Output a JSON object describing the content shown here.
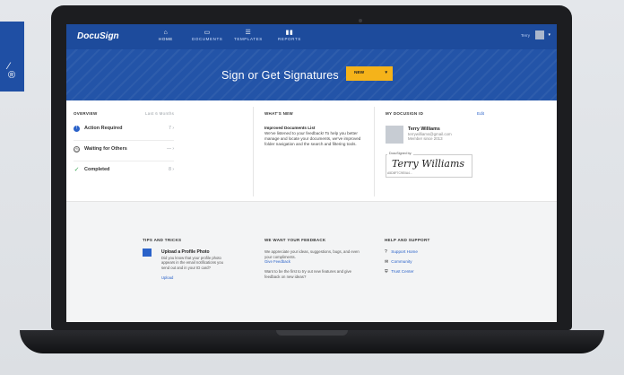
{
  "app": {
    "logo": "DocuSign"
  },
  "nav": [
    {
      "label": "HOME",
      "icon": "⌂",
      "active": true
    },
    {
      "label": "DOCUMENTS",
      "icon": "▭"
    },
    {
      "label": "TEMPLATES",
      "icon": "☰"
    },
    {
      "label": "REPORTS",
      "icon": "▮▮"
    }
  ],
  "header": {
    "user": "Terry",
    "hero_title": "Sign or Get Signatures",
    "new_button": "NEW"
  },
  "overview": {
    "title": "OVERVIEW",
    "period": "Last 6 Months",
    "items": [
      {
        "label": "Action Required",
        "count": "7"
      },
      {
        "label": "Waiting for Others",
        "count": "—"
      },
      {
        "label": "Completed",
        "count": "8"
      }
    ]
  },
  "whats_new": {
    "title": "WHAT'S NEW",
    "headline": "Improved Documents List",
    "body": "We've listened to your feedback! To help you better manage and locate your documents, we've improved folder navigation and the search and filtering tools."
  },
  "my_id": {
    "title": "MY DOCUSIGN ID",
    "edit": "Edit",
    "name": "Terry Williams",
    "email": "terrywilliams@gmail.com",
    "since": "Member since 2013",
    "sig_label": "DocuSigned by:",
    "signature": "Terry Williams",
    "sig_id": "A5D8F7C9E0A4..."
  },
  "tips": {
    "title": "TIPS AND TRICKS",
    "item_title": "Upload a Profile Photo",
    "item_body": "Did you know that your profile photo appears in the email notifications you send out and in your ID card?",
    "link": "Upload"
  },
  "feedback": {
    "title": "WE WANT YOUR FEEDBACK",
    "body1": "We appreciate your ideas, suggestions, bugs, and even your compliments.",
    "link": "Give Feedback",
    "body2": "Want to be the first to try out new features and give feedback on new ideas?"
  },
  "help": {
    "title": "HELP AND SUPPORT",
    "items": [
      {
        "label": "Support Home",
        "icon": "?"
      },
      {
        "label": "Community",
        "icon": "✉"
      },
      {
        "label": "Trust Center",
        "icon": "⛨"
      }
    ]
  },
  "colors": {
    "brand": "#2354a8",
    "accent": "#f5b31a",
    "link": "#2a62c9"
  }
}
